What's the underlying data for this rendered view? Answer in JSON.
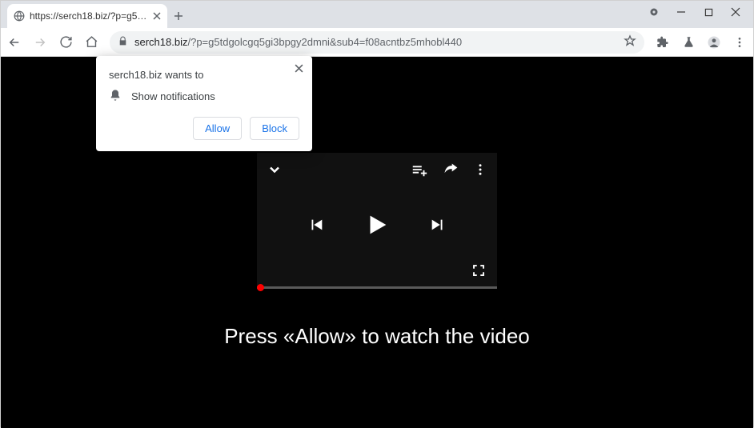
{
  "window": {
    "tab_title": "https://serch18.biz/?p=g5tdgolc"
  },
  "addressbar": {
    "domain": "serch18.biz",
    "rest": "/?p=g5tdgolcgq5gi3bpgy2dmni&sub4=f08acntbz5mhobl440"
  },
  "permission_popup": {
    "title": "serch18.biz wants to",
    "item": "Show notifications",
    "allow_label": "Allow",
    "block_label": "Block"
  },
  "page": {
    "caption": "Press «Allow» to watch the video"
  }
}
